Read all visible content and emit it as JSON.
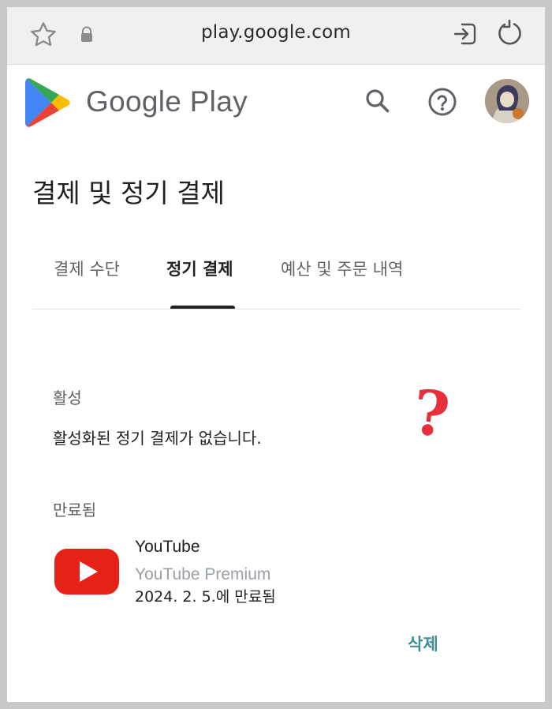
{
  "browser": {
    "url": "play.google.com",
    "icons": [
      "star-icon",
      "lock-icon",
      "sign-in-icon",
      "reload-icon"
    ]
  },
  "header": {
    "brand": "Google Play",
    "icons": [
      "search-icon",
      "help-icon"
    ]
  },
  "page": {
    "title": "결제 및 정기 결제"
  },
  "tabs": [
    {
      "label": "결제 수단",
      "active": false
    },
    {
      "label": "정기 결제",
      "active": true
    },
    {
      "label": "예산 및 주문 내역",
      "active": false
    }
  ],
  "active_section": {
    "label": "활성",
    "empty_message": "활성화된 정기 결제가 없습니다."
  },
  "annotation": {
    "mark": "?",
    "color": "#e8303c"
  },
  "expired_section": {
    "label": "만료됨",
    "items": [
      {
        "name": "YouTube",
        "plan": "YouTube Premium",
        "status": "2024. 2. 5.에 만료됨",
        "icon": "youtube-icon"
      }
    ],
    "delete_label": "삭제"
  },
  "colors": {
    "accent": "#3f8f99",
    "youtube_red": "#e62117"
  }
}
